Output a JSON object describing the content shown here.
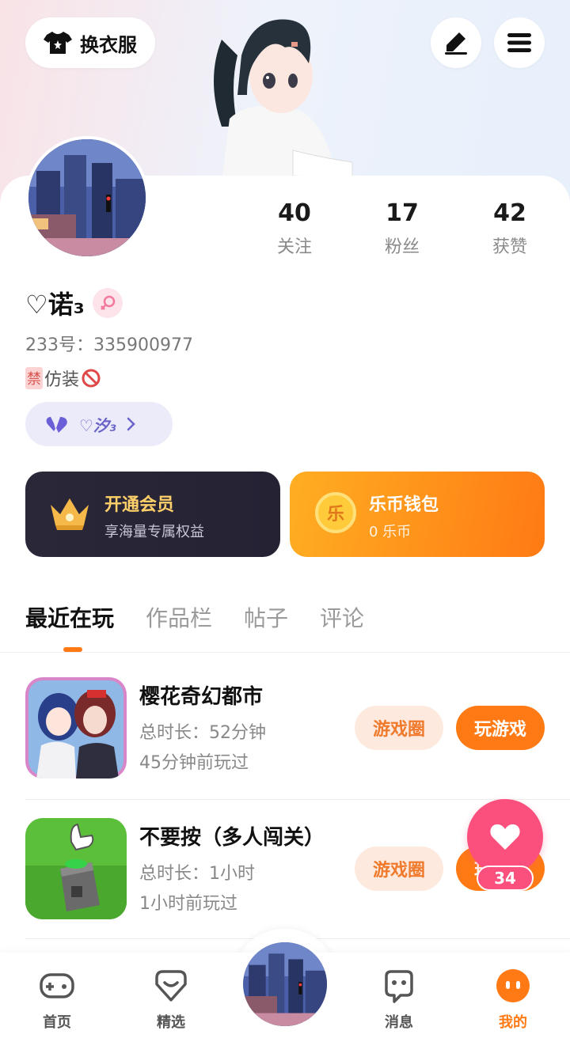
{
  "header": {
    "outfit_label": "换衣服",
    "icons": [
      "tshirt-icon",
      "edit-icon",
      "menu-icon"
    ]
  },
  "profile": {
    "stats": [
      {
        "value": "40",
        "label": "关注"
      },
      {
        "value": "17",
        "label": "粉丝"
      },
      {
        "value": "42",
        "label": "获赞"
      }
    ],
    "nickname": "♡诺₃",
    "uid": "233号：335900977",
    "signature_tag": "禁",
    "signature_text": "仿装",
    "cp_name": "♡汐₃"
  },
  "cards": {
    "vip_title": "开通会员",
    "vip_sub": "享海量专属权益",
    "wallet_title": "乐币钱包",
    "wallet_sub": "0 乐币",
    "wallet_coin_char": "乐"
  },
  "tabs": [
    {
      "label": "最近在玩",
      "active": true
    },
    {
      "label": "作品栏",
      "active": false
    },
    {
      "label": "帖子",
      "active": false
    },
    {
      "label": "评论",
      "active": false
    }
  ],
  "games": [
    {
      "title": "樱花奇幻都市",
      "duration": "总时长：52分钟",
      "last_played": "45分钟前玩过",
      "circle_label": "游戏圈",
      "play_label": "玩游戏"
    },
    {
      "title": "不要按（多人闯关）",
      "duration": "总时长：1小时",
      "last_played": "1小时前玩过",
      "circle_label": "游戏圈",
      "play_label": "玩游戏"
    }
  ],
  "float_like": {
    "count": "34"
  },
  "bottom_nav": [
    {
      "label": "首页",
      "icon": "gamepad-icon"
    },
    {
      "label": "精选",
      "icon": "heart-chat-icon"
    },
    {
      "label": "消息",
      "icon": "message-icon"
    },
    {
      "label": "我的",
      "icon": "profile-dots-icon",
      "active": true
    }
  ],
  "colors": {
    "accent": "#ff7a14",
    "like": "#fb4f7d",
    "vip_gold": "#ffd06a"
  }
}
